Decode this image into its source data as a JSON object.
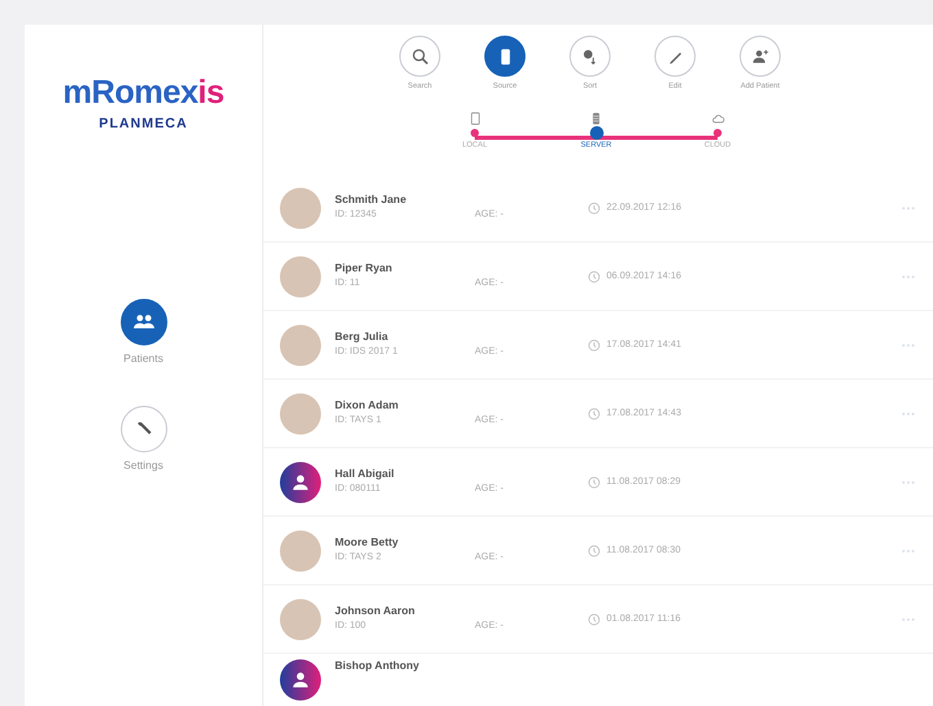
{
  "sidebar": {
    "logo": {
      "main": "mRomex",
      "accent": "is",
      "brand": "PLANMECA"
    },
    "items": [
      {
        "label": "Patients",
        "selected": true
      },
      {
        "label": "Settings",
        "selected": false
      }
    ]
  },
  "toolbar": [
    {
      "label": "Search",
      "selected": false
    },
    {
      "label": "Source",
      "selected": true
    },
    {
      "label": "Sort",
      "selected": false
    },
    {
      "label": "Edit",
      "selected": false
    },
    {
      "label": "Add Patient",
      "selected": false
    }
  ],
  "source": [
    {
      "label": "LOCAL",
      "selected": false
    },
    {
      "label": "SERVER",
      "selected": true
    },
    {
      "label": "CLOUD",
      "selected": false
    }
  ],
  "patients": [
    {
      "name": "Schmith Jane",
      "id": "ID: 12345",
      "age": "AGE: -",
      "date": "22.09.2017 12:16",
      "kind": "photo"
    },
    {
      "name": "Piper Ryan",
      "id": "ID: 11",
      "age": "AGE: -",
      "date": "06.09.2017 14:16",
      "kind": "photo"
    },
    {
      "name": "Berg Julia",
      "id": "ID: IDS 2017 1",
      "age": "AGE: -",
      "date": "17.08.2017 14:41",
      "kind": "photo"
    },
    {
      "name": "Dixon Adam",
      "id": "ID: TAYS 1",
      "age": "AGE: -",
      "date": "17.08.2017 14:43",
      "kind": "photo"
    },
    {
      "name": "Hall Abigail",
      "id": "ID: 080111",
      "age": "AGE: -",
      "date": "11.08.2017 08:29",
      "kind": "icon"
    },
    {
      "name": "Moore Betty",
      "id": "ID: TAYS 2",
      "age": "AGE: -",
      "date": "11.08.2017 08:30",
      "kind": "photo"
    },
    {
      "name": "Johnson Aaron",
      "id": "ID: 100",
      "age": "AGE: -",
      "date": "01.08.2017 11:16",
      "kind": "photo"
    },
    {
      "name": "Bishop Anthony",
      "kind": "icon"
    }
  ]
}
